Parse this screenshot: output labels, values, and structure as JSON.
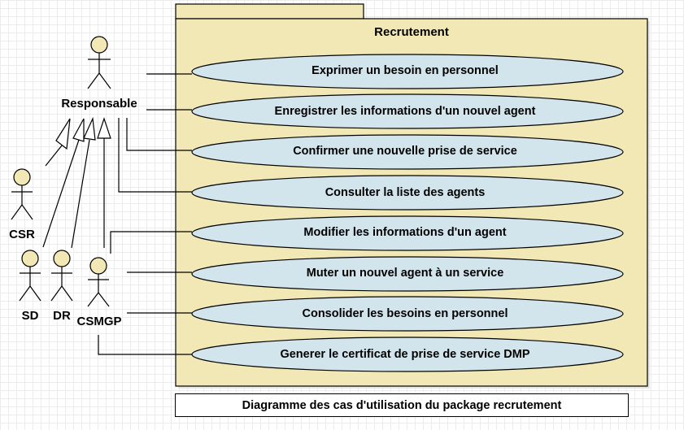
{
  "package": {
    "title": "Recrutement"
  },
  "use_cases": [
    "Exprimer un besoin en personnel",
    "Enregistrer les informations d'un nouvel agent",
    "Confirmer une nouvelle prise de service",
    "Consulter la liste des agents",
    "Modifier les informations d'un agent",
    "Muter un nouvel agent à un service",
    "Consolider les besoins en personnel",
    "Generer le certificat de prise de service DMP"
  ],
  "actors": {
    "responsable": "Responsable",
    "csr": "CSR",
    "sd": "SD",
    "dr": "DR",
    "csmgp": "CSMGP"
  },
  "caption": "Diagramme des cas d'utilisation du package recrutement",
  "colors": {
    "package_fill": "#f2e8b5",
    "use_case_fill": "#d2e5ec",
    "actor_fill": "#f2e8b5",
    "stroke": "#000000"
  }
}
